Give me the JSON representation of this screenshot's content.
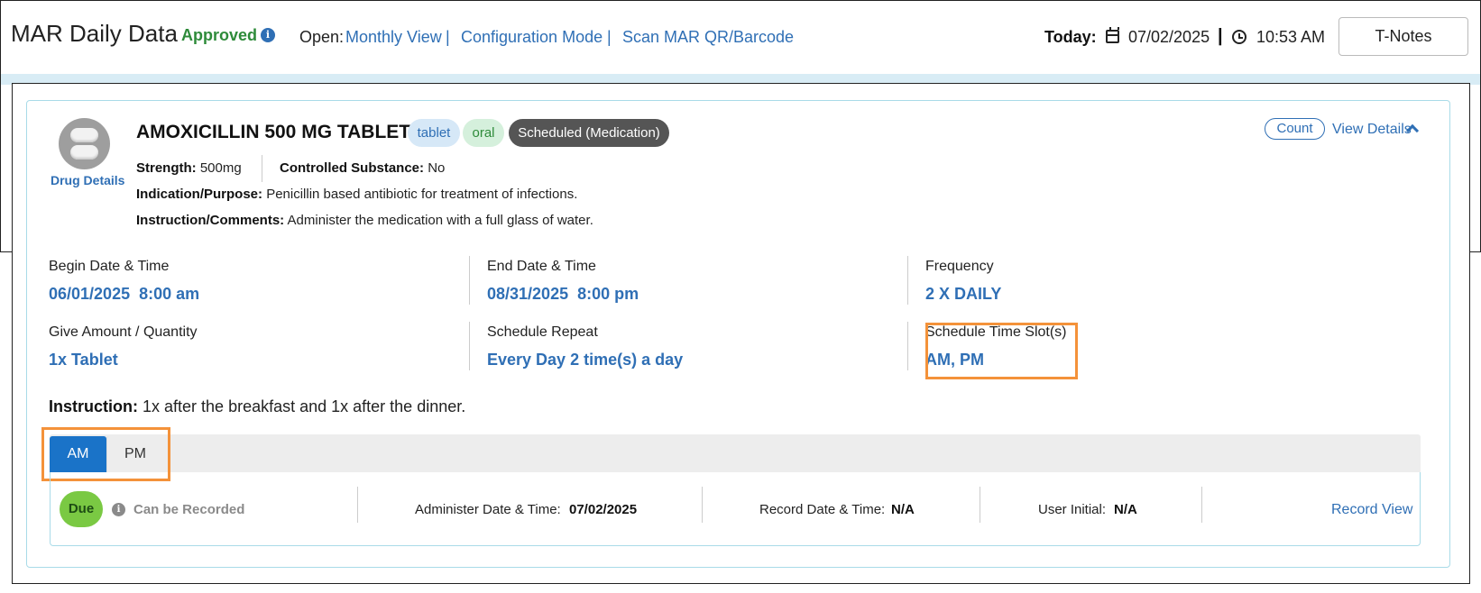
{
  "header": {
    "title": "MAR Daily Data",
    "status": "Approved",
    "info_icon": "i",
    "open_label": "Open:",
    "links": [
      "Monthly View",
      "Configuration Mode",
      "Scan MAR QR/Barcode"
    ],
    "separator": "|",
    "today_label": "Today:",
    "today_date": "07/02/2025",
    "today_separator": "|",
    "today_time": "10:53 AM",
    "tnotes_label": "T-Notes"
  },
  "drug": {
    "details_link": "Drug Details",
    "name": "AMOXICILLIN 500 MG TABLET",
    "badges": [
      "tablet",
      "oral",
      "Scheduled (Medication)"
    ],
    "count_label": "Count",
    "view_details_label": "View Details",
    "strength_label": "Strength:",
    "strength_value": "500mg",
    "controlled_label": "Controlled Substance:",
    "controlled_value": "No",
    "indication_label": "Indication/Purpose:",
    "indication_value": "Penicillin based antibiotic for treatment of infections.",
    "instruction_comments_label": "Instruction/Comments:",
    "instruction_comments_value": "Administer the medication with a full glass of water."
  },
  "fields": {
    "begin_label": "Begin Date & Time",
    "begin_value": "06/01/2025  8:00 am",
    "end_label": "End Date & Time",
    "end_value": "08/31/2025  8:00 pm",
    "frequency_label": "Frequency",
    "frequency_value": "2 X DAILY",
    "give_label": "Give Amount / Quantity",
    "give_value": "1x Tablet",
    "repeat_label": "Schedule Repeat",
    "repeat_value": "Every Day 2 time(s) a day",
    "slots_label": "Schedule Time Slot(s)",
    "slots_value": "AM, PM"
  },
  "instruction": {
    "label": "Instruction:",
    "value": "1x after the breakfast and 1x after the dinner."
  },
  "tabs": [
    "AM",
    "PM"
  ],
  "record": {
    "due_label": "Due",
    "can_record_label": "Can be Recorded",
    "administer_label": "Administer Date & Time:",
    "administer_value": "07/02/2025",
    "record_label": "Record Date & Time:",
    "record_value": "N/A",
    "initial_label": "User Initial:",
    "initial_value": "N/A",
    "record_view_label": "Record View"
  }
}
